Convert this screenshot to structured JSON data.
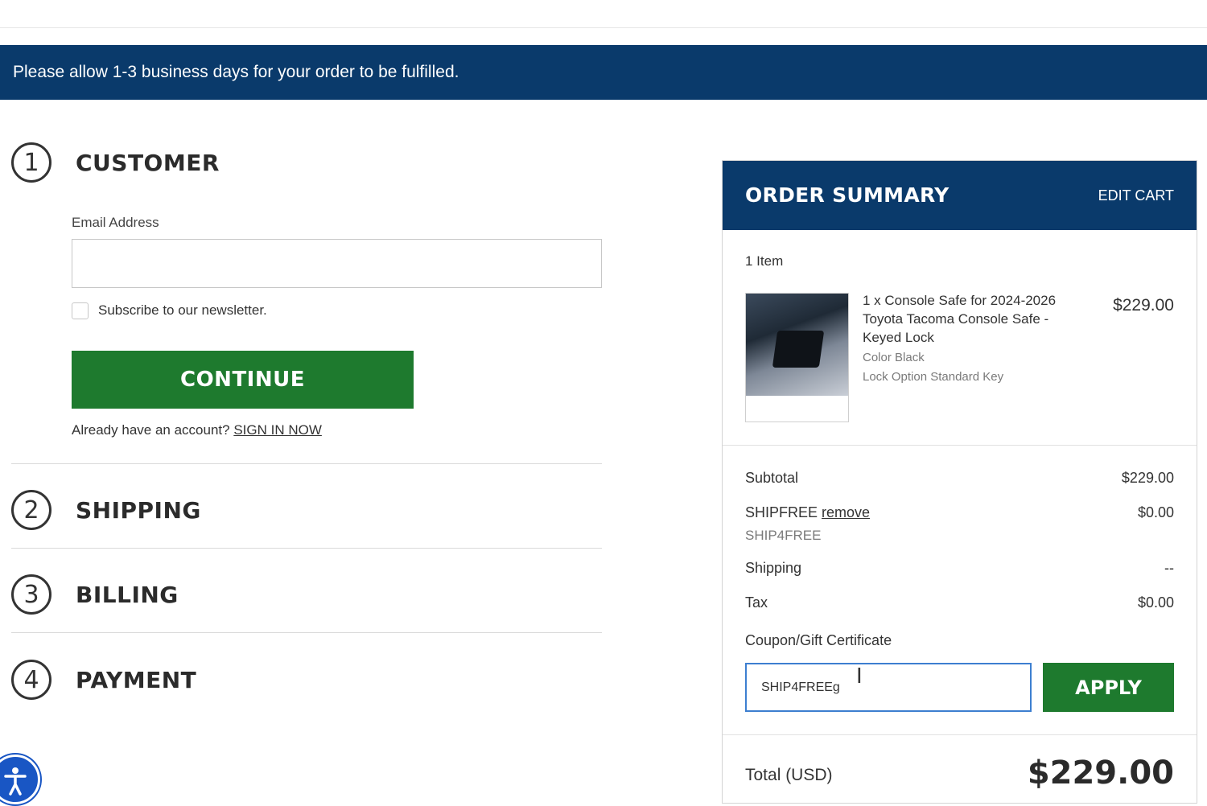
{
  "banner": {
    "text": "Please allow 1-3 business days for your order to be fulfilled."
  },
  "steps": [
    {
      "number": "1",
      "title": "CUSTOMER"
    },
    {
      "number": "2",
      "title": "SHIPPING"
    },
    {
      "number": "3",
      "title": "BILLING"
    },
    {
      "number": "4",
      "title": "PAYMENT"
    }
  ],
  "customer": {
    "email_label": "Email Address",
    "email_value": "",
    "newsletter_label": "Subscribe to our newsletter.",
    "newsletter_checked": false,
    "continue_label": "CONTINUE",
    "signin_prompt": "Already have an account?",
    "signin_link": "SIGN IN NOW"
  },
  "summary": {
    "title": "ORDER SUMMARY",
    "edit_cart": "EDIT CART",
    "item_count": "1 Item",
    "item": {
      "name_line1": "1 x Console Safe for 2024-2026",
      "name_line2": "Toyota Tacoma Console Safe -",
      "name_line3": "Keyed Lock",
      "option_color": "Color Black",
      "option_lock": "Lock Option Standard Key",
      "price": "$229.00"
    },
    "subtotal_label": "Subtotal",
    "subtotal_value": "$229.00",
    "discount_label": "SHIPFREE",
    "discount_remove": "remove",
    "discount_value": "$0.00",
    "discount_code": "SHIP4FREE",
    "shipping_label": "Shipping",
    "shipping_value": "--",
    "tax_label": "Tax",
    "tax_value": "$0.00",
    "coupon_label": "Coupon/Gift Certificate",
    "coupon_value": "SHIP4FREEg",
    "apply_label": "APPLY",
    "total_label": "Total (USD)",
    "total_value": "$229.00"
  },
  "colors": {
    "banner": "#0a3a6b",
    "button_green": "#1e7a2e",
    "focus_blue": "#3d7fd0"
  },
  "icons": {
    "accessibility": "accessibility-icon",
    "text_cursor": "text-cursor-icon"
  }
}
